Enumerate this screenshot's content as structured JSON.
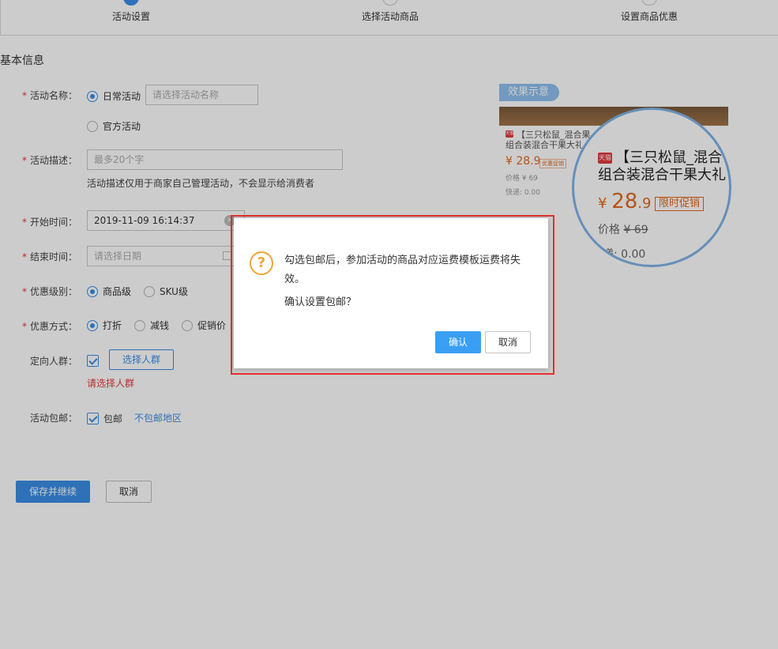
{
  "steps": [
    {
      "label": "活动设置",
      "active": true
    },
    {
      "label": "选择活动商品",
      "active": false
    },
    {
      "label": "设置商品优惠",
      "active": false
    }
  ],
  "section_title": "基本信息",
  "form": {
    "name_label": "活动名称：",
    "name_option_daily": "日常活动",
    "name_placeholder": "请选择活动名称",
    "name_option_official": "官方活动",
    "desc_label": "活动描述：",
    "desc_placeholder": "最多20个字",
    "desc_hint": "活动描述仅用于商家自己管理活动，不会显示给消费者",
    "start_label": "开始时间：",
    "start_value": "2019-11-09 16:14:37",
    "end_label": "结束时间：",
    "end_placeholder": "请选择日期",
    "level_label": "优惠级别：",
    "level_options": [
      "商品级",
      "SKU级"
    ],
    "method_label": "优惠方式：",
    "method_options": [
      "打折",
      "减钱",
      "促销价"
    ],
    "crowd_label": "定向人群：",
    "crowd_button": "选择人群",
    "crowd_error": "请选择人群",
    "shipping_label": "活动包邮：",
    "shipping_checkbox": "包邮",
    "shipping_link": "不包邮地区",
    "required_mark": "*",
    "clear_glyph": "×"
  },
  "actions": {
    "save": "保存并继续",
    "cancel": "取消"
  },
  "preview": {
    "tag": "效果示意",
    "small_title": "【三只松鼠_混合果",
    "small_title2": "组合装混合干果大礼",
    "small_price": "¥ 28.9",
    "small_promo": "优惠促销",
    "small_orig": "价格 ¥ 69",
    "small_ship": "快递: 0.00",
    "badge": "天猫",
    "title_line1": "【三只松鼠_混合",
    "title_line2": "组合装混合干果大礼",
    "currency": "¥ ",
    "price_int": "28",
    "price_dec": ".9",
    "promo_badge": "限时促销",
    "orig_label": "价格 ",
    "orig_price": "¥ 69",
    "shipping": "快递: 0.00"
  },
  "dialog": {
    "icon": "?",
    "message": "勾选包邮后，参加活动的商品对应运费模板运费将失效。",
    "confirm_question": "确认设置包邮？",
    "ok": "确认",
    "cancel": "取消"
  }
}
